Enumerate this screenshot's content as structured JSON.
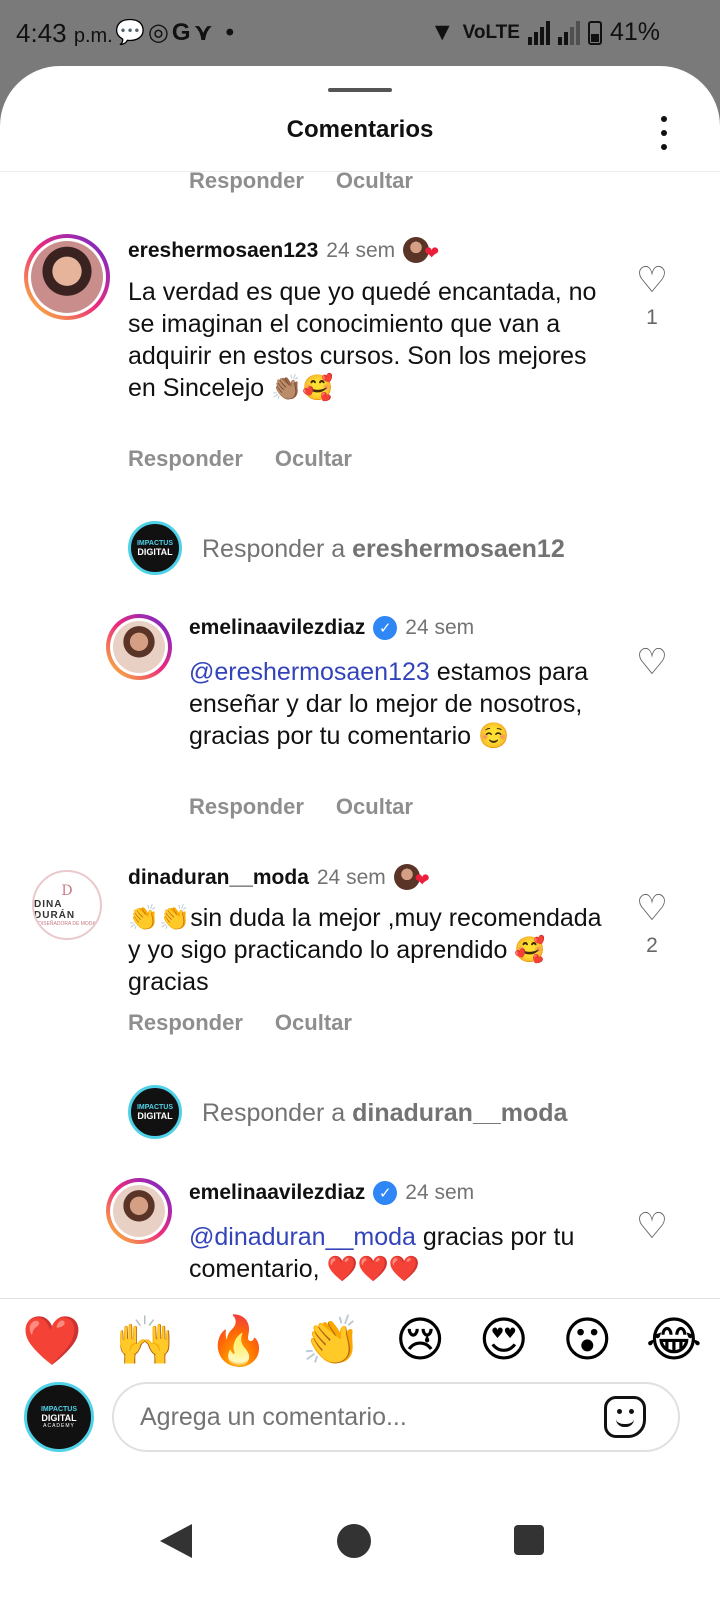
{
  "status_bar": {
    "time": "4:43",
    "ampm": "p.m.",
    "notification_icons": "💬◎G⋎ •",
    "network": "VoLTE",
    "battery": "41%"
  },
  "sheet": {
    "title": "Comentarios"
  },
  "actions": {
    "reply": "Responder",
    "hide": "Ocultar"
  },
  "comments": [
    {
      "username": "ereshermosaen123",
      "time": "24 sem",
      "text": "La verdad es que yo quedé encantada, no se imaginan el conocimiento que van a adquirir en estos cursos. Son los mejores en Sincelejo 👏🏽🥰",
      "likes": "1",
      "reply_prompt_prefix": "Responder a",
      "reply_prompt_user": "ereshermosaen12",
      "reply": {
        "username": "emelinaavilezdiaz",
        "time": "24 sem",
        "mention": "@ereshermosaen123",
        "text": " estamos para enseñar y dar lo mejor de nosotros, gracias por tu comentario ☺️"
      }
    },
    {
      "username": "dinaduran__moda",
      "time": "24 sem",
      "text": "👏👏sin duda la mejor ,muy recomendada y  yo sigo practicando lo aprendido 🥰gracias",
      "likes": "2",
      "avatar_logo": "D",
      "avatar_name": "DINA DURÁN",
      "avatar_sub": "DISEÑADORA DE MODA",
      "reply_prompt_prefix": "Responder a",
      "reply_prompt_user": "dinaduran__moda",
      "reply": {
        "username": "emelinaavilezdiaz",
        "time": "24 sem",
        "mention": "@dinaduran__moda",
        "text": " gracias por tu comentario, ❤️❤️❤️"
      }
    }
  ],
  "page_avatar": {
    "line1": "IMPACTUS",
    "line2": "DIGITAL",
    "line3": "ACADEMY"
  },
  "emoji_bar": [
    "❤️",
    "🙌",
    "🔥",
    "👏",
    "😢",
    "😍",
    "😮",
    "😂"
  ],
  "composer": {
    "placeholder": "Agrega un comentario..."
  },
  "icons": {
    "heart": "heart-outline-icon",
    "verified": "verified-badge-icon",
    "more": "more-vertical-icon",
    "sticker": "sticker-icon"
  },
  "colors": {
    "mention": "#3344bb",
    "verified": "#2f86f5",
    "muted": "#737373",
    "story_ring": "#ee2a7b"
  }
}
